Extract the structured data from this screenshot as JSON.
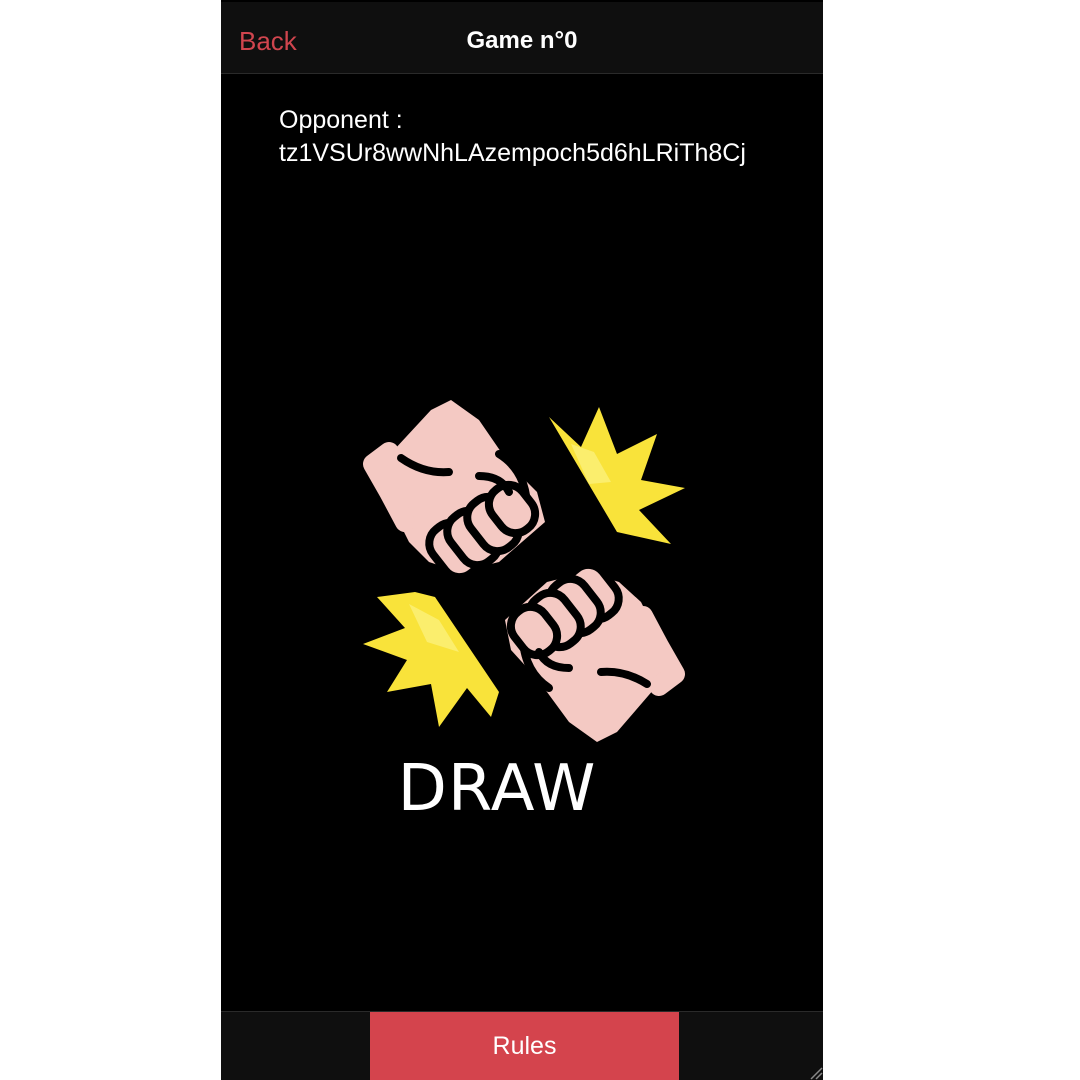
{
  "header": {
    "back_label": "Back",
    "title": "Game n°0"
  },
  "opponent": {
    "label": "Opponent :",
    "address": "tz1VSUr8wwNhLAzempoch5d6hLRiTh8Cj"
  },
  "result": {
    "icon": "fist-bump-icon",
    "label": "DRAW"
  },
  "footer": {
    "rules_label": "Rules"
  },
  "colors": {
    "background": "#000000",
    "bar": "#0f0f0f",
    "accent": "#d4444d",
    "back_link": "#d0454e",
    "skin": "#f4c9c3",
    "spark": "#f9e33a"
  }
}
